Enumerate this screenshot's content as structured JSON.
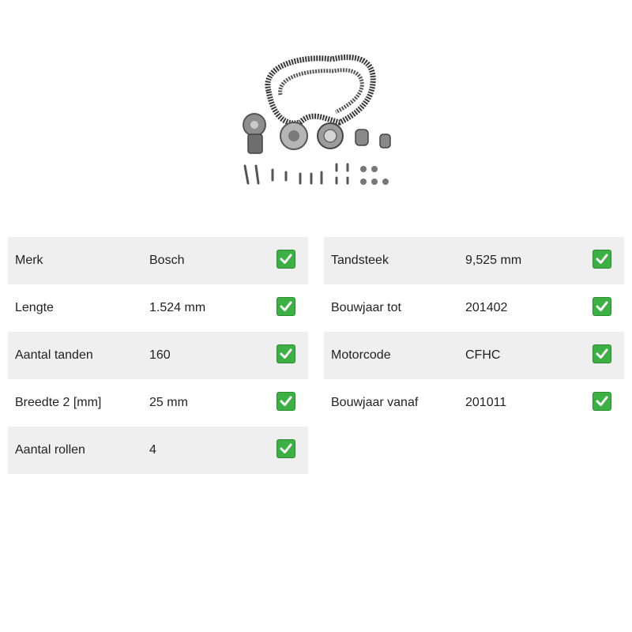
{
  "product": {
    "image_icon": "timing-belt-kit-with-water-pump"
  },
  "colors": {
    "row_shade": "#efefef",
    "check_green": "#3cb043"
  },
  "specs_left": [
    {
      "label": "Merk",
      "value": "Bosch",
      "icon": "check-icon"
    },
    {
      "label": "Lengte",
      "value": "1.524 mm",
      "icon": "check-icon"
    },
    {
      "label": "Aantal tanden",
      "value": "160",
      "icon": "check-icon"
    },
    {
      "label": "Breedte 2 [mm]",
      "value": "25 mm",
      "icon": "check-icon"
    },
    {
      "label": "Aantal rollen",
      "value": "4",
      "icon": "check-icon"
    }
  ],
  "specs_right": [
    {
      "label": "Tandsteek",
      "value": "9,525 mm",
      "icon": "check-icon"
    },
    {
      "label": "Bouwjaar tot",
      "value": "201402",
      "icon": "check-icon"
    },
    {
      "label": "Motorcode",
      "value": "CFHC",
      "icon": "check-icon"
    },
    {
      "label": "Bouwjaar vanaf",
      "value": "201011",
      "icon": "check-icon"
    }
  ]
}
